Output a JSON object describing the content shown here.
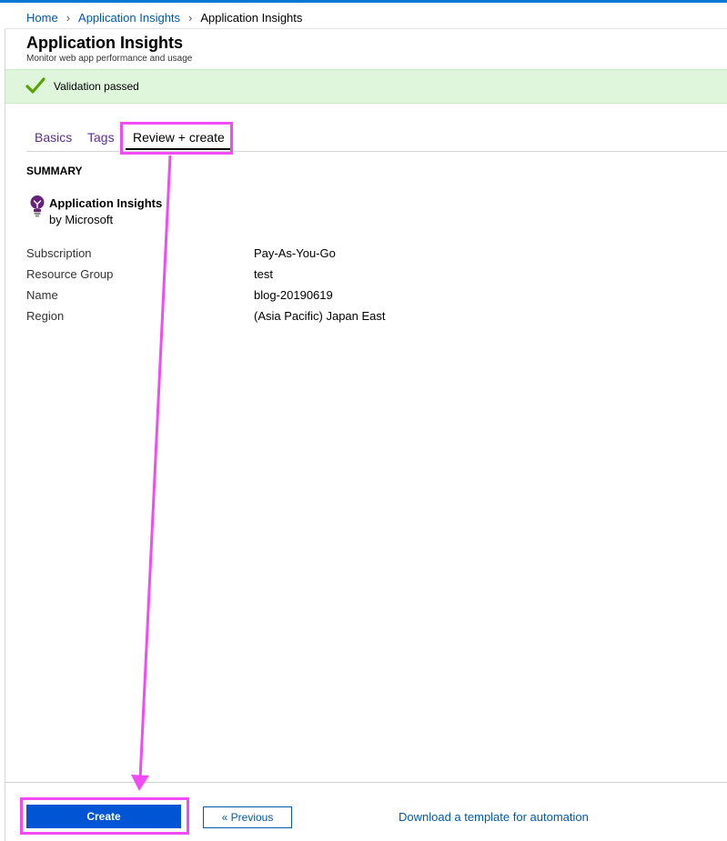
{
  "breadcrumb": {
    "items": [
      "Home",
      "Application Insights",
      "Application Insights"
    ],
    "separator_icon": "chevron-right-icon"
  },
  "header": {
    "title": "Application Insights",
    "subtitle": "Monitor web app performance and usage"
  },
  "validation": {
    "text": "Validation passed",
    "icon": "checkmark-icon",
    "color": "#57a300"
  },
  "tabs": [
    {
      "label": "Basics"
    },
    {
      "label": "Tags"
    },
    {
      "label": "Review + create",
      "selected": true
    }
  ],
  "summary": {
    "heading": "SUMMARY",
    "product_name": "Application Insights",
    "publisher": "by Microsoft",
    "icon": "lightbulb-icon",
    "rows": [
      {
        "label": "Subscription",
        "value": "Pay-As-You-Go"
      },
      {
        "label": "Resource Group",
        "value": "test"
      },
      {
        "label": "Name",
        "value": "blog-20190619"
      },
      {
        "label": "Region",
        "value": "(Asia Pacific) Japan East"
      }
    ]
  },
  "footer": {
    "create_label": "Create",
    "previous_label": "« Previous",
    "download_label": "Download a template for automation"
  },
  "colors": {
    "accent": "#0055d4",
    "highlight": "#f04bf5",
    "validation_bg": "#dff6dd",
    "tab_text": "#5c2d91"
  }
}
